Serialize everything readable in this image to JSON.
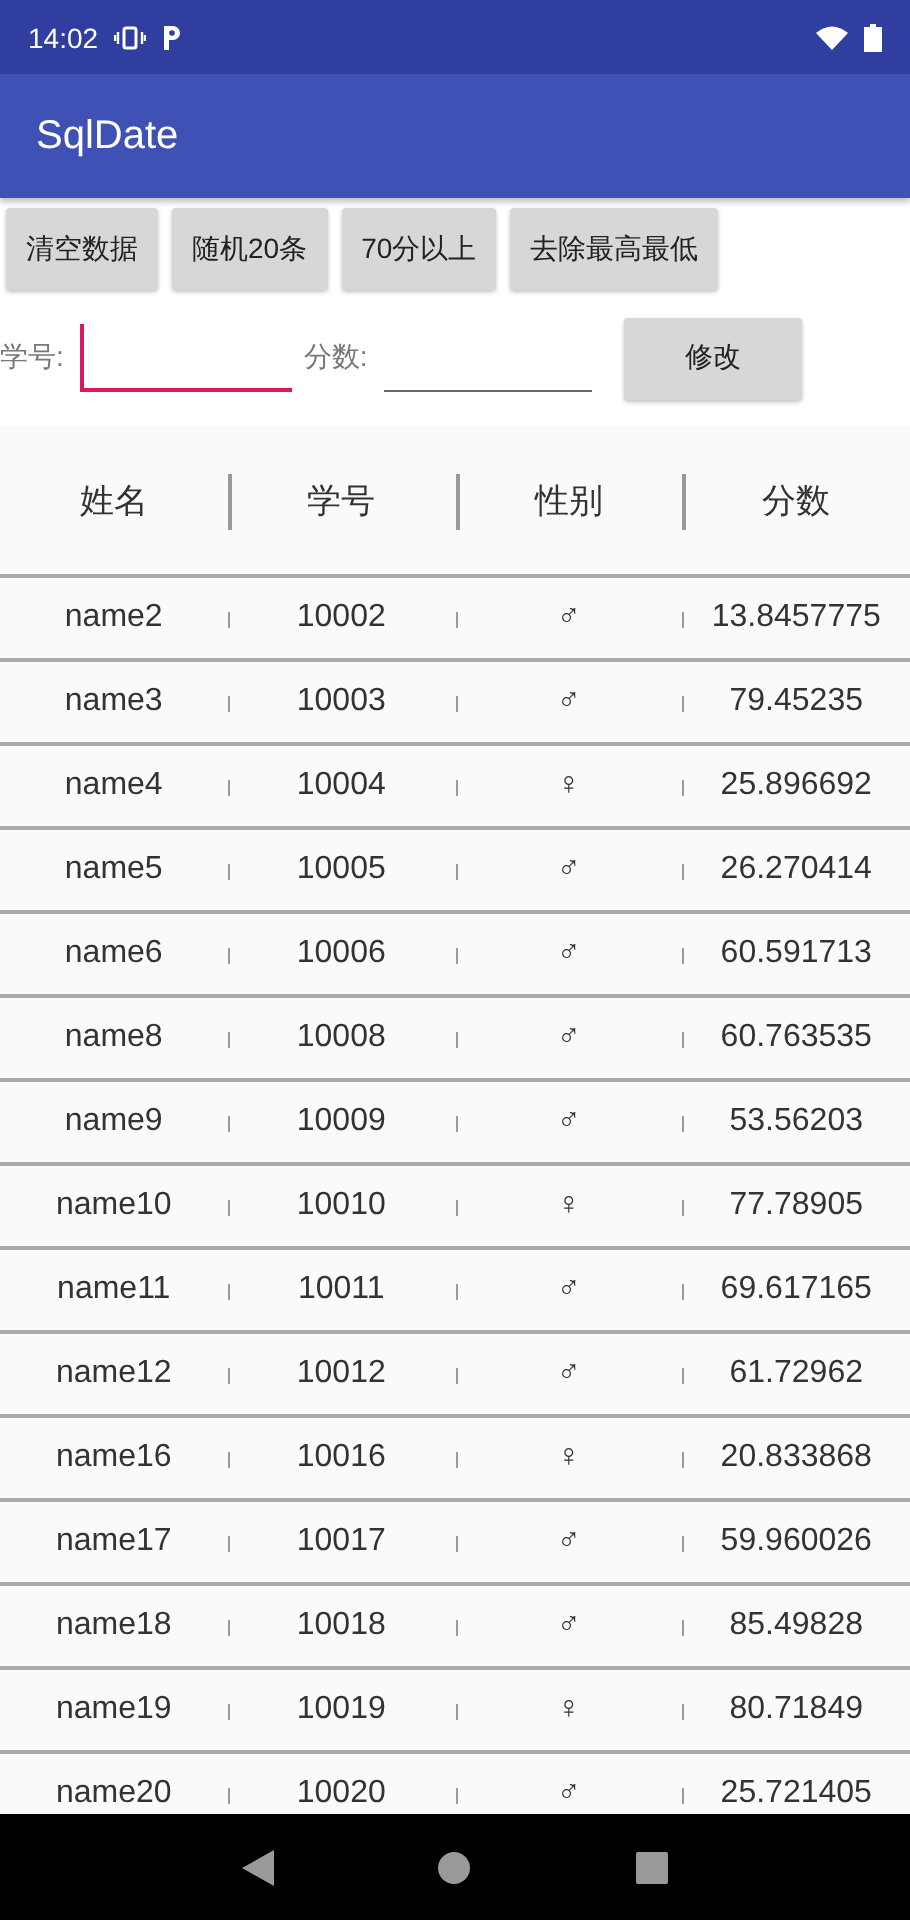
{
  "status_bar": {
    "time": "14:02"
  },
  "app_bar": {
    "title": "SqlDate"
  },
  "buttons": [
    "清空数据",
    "随机20条",
    "70分以上",
    "去除最高最低"
  ],
  "form": {
    "fields": [
      {
        "label": "学号:",
        "focused": true
      },
      {
        "label": "分数:",
        "focused": false
      }
    ],
    "button": "修改"
  },
  "table": {
    "columns": [
      "姓名",
      "学号",
      "性别",
      "分数"
    ],
    "rows": [
      {
        "name": "name2",
        "id": "10002",
        "gender": "♂",
        "score": "13.8457775"
      },
      {
        "name": "name3",
        "id": "10003",
        "gender": "♂",
        "score": "79.45235"
      },
      {
        "name": "name4",
        "id": "10004",
        "gender": "♀",
        "score": "25.896692"
      },
      {
        "name": "name5",
        "id": "10005",
        "gender": "♂",
        "score": "26.270414"
      },
      {
        "name": "name6",
        "id": "10006",
        "gender": "♂",
        "score": "60.591713"
      },
      {
        "name": "name8",
        "id": "10008",
        "gender": "♂",
        "score": "60.763535"
      },
      {
        "name": "name9",
        "id": "10009",
        "gender": "♂",
        "score": "53.56203"
      },
      {
        "name": "name10",
        "id": "10010",
        "gender": "♀",
        "score": "77.78905"
      },
      {
        "name": "name11",
        "id": "10011",
        "gender": "♂",
        "score": "69.617165"
      },
      {
        "name": "name12",
        "id": "10012",
        "gender": "♂",
        "score": "61.72962"
      },
      {
        "name": "name16",
        "id": "10016",
        "gender": "♀",
        "score": "20.833868"
      },
      {
        "name": "name17",
        "id": "10017",
        "gender": "♂",
        "score": "59.960026"
      },
      {
        "name": "name18",
        "id": "10018",
        "gender": "♂",
        "score": "85.49828"
      },
      {
        "name": "name19",
        "id": "10019",
        "gender": "♀",
        "score": "80.71849"
      },
      {
        "name": "name20",
        "id": "10020",
        "gender": "♂",
        "score": "25.721405"
      }
    ]
  }
}
